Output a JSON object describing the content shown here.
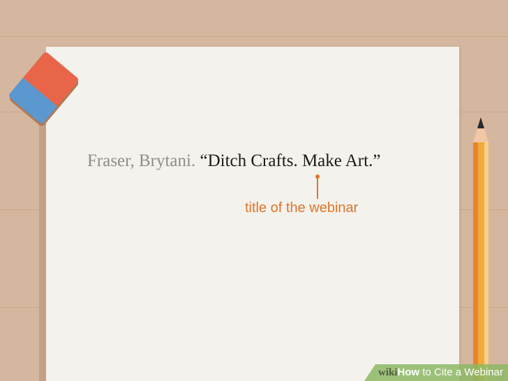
{
  "citation": {
    "author": "Fraser, Brytani.",
    "title": "“Ditch Crafts. Make Art.”"
  },
  "annotation": {
    "label": "title of the webinar",
    "color": "#e0742a"
  },
  "watermark": {
    "wiki": "wiki",
    "how": "How",
    "rest": " to Cite a Webinar"
  },
  "decor": {
    "eraser_colors": [
      "#e8654a",
      "#5b98cf"
    ],
    "pencil_color": "#f0a030"
  }
}
